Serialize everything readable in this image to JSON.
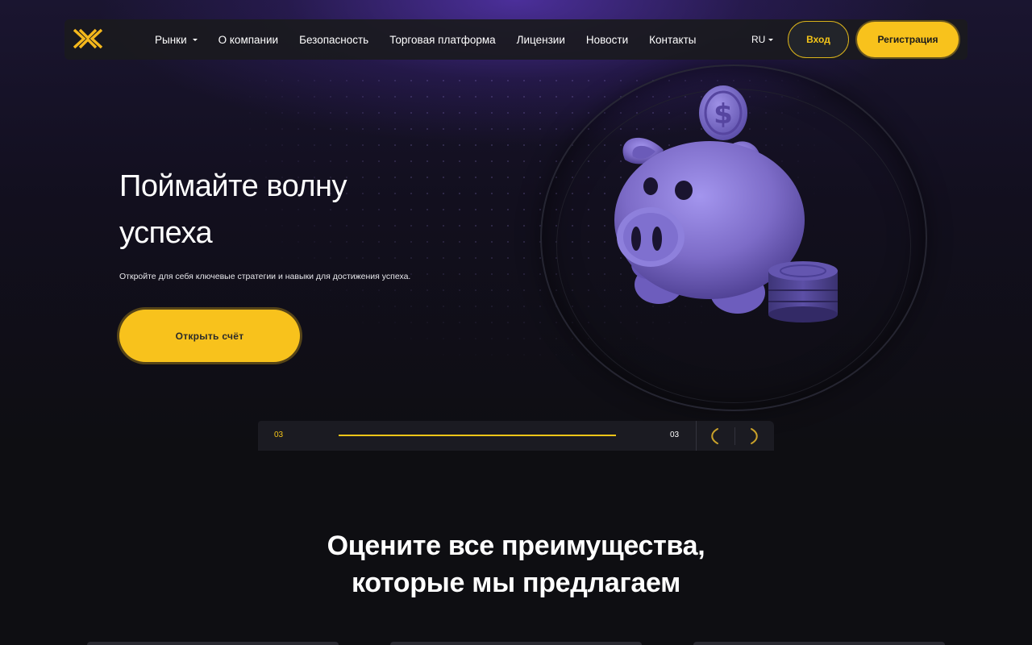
{
  "header": {
    "nav": [
      {
        "label": "Рынки",
        "dropdown": true
      },
      {
        "label": "О компании"
      },
      {
        "label": "Безопасность"
      },
      {
        "label": "Торговая платформа"
      },
      {
        "label": "Лицензии"
      },
      {
        "label": "Новости"
      },
      {
        "label": "Контакты"
      }
    ],
    "language": "RU",
    "login_label": "Вход",
    "register_label": "Регистрация"
  },
  "hero": {
    "title_line1": "Поймайте волну",
    "title_line2": "успеха",
    "subtitle": "Откройте для себя ключевые стратегии и навыки для достижения успеха.",
    "cta_label": "Открыть счёт",
    "illustration": "piggy-bank-with-coins"
  },
  "slider": {
    "current": "03",
    "total": "03",
    "progress": 1.0
  },
  "advantages": {
    "title_line1": "Оцените все преимущества,",
    "title_line2": "которые мы предлагаем"
  },
  "colors": {
    "accent": "#f8c21c",
    "background": "#0e0e12",
    "purple_glow": "#5c38be",
    "pig": "#8878d4"
  }
}
